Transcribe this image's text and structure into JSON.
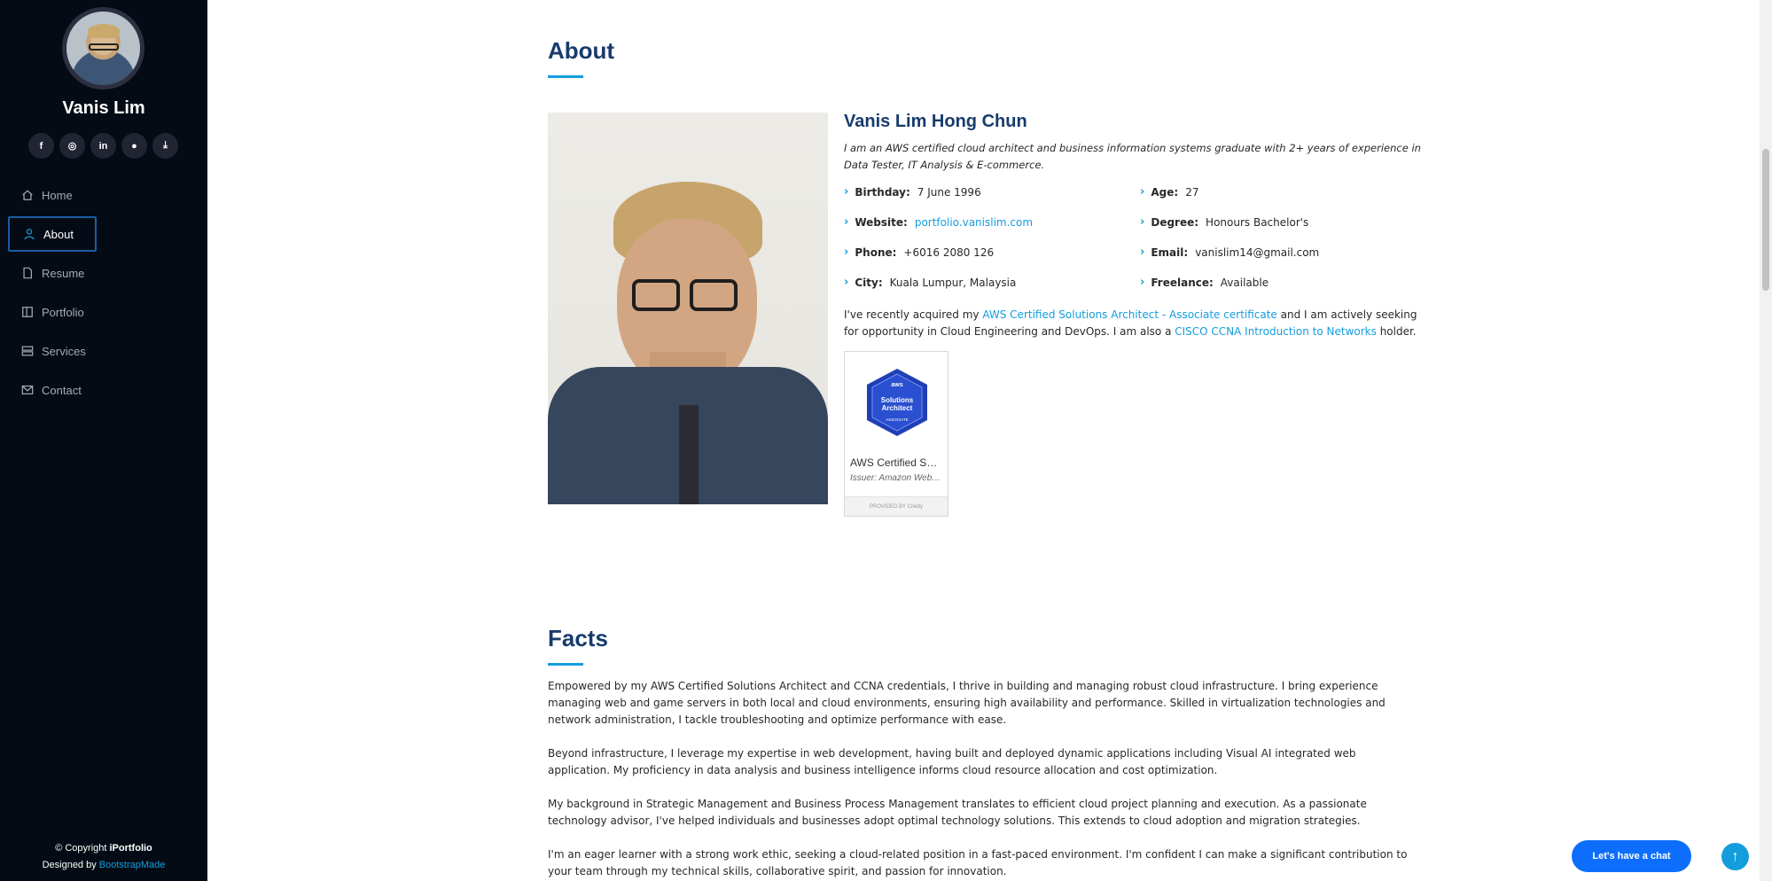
{
  "sidebar": {
    "name": "Vanis Lim",
    "socials": [
      {
        "icon": "facebook-icon",
        "glyph": "f"
      },
      {
        "icon": "instagram-icon",
        "glyph": "◎"
      },
      {
        "icon": "linkedin-icon",
        "glyph": "in"
      },
      {
        "icon": "github-icon",
        "glyph": "●"
      },
      {
        "icon": "download-icon",
        "glyph": "⤓"
      }
    ],
    "nav": [
      {
        "label": "Home",
        "icon": "house-icon",
        "active": false
      },
      {
        "label": "About",
        "icon": "person-icon",
        "active": true
      },
      {
        "label": "Resume",
        "icon": "file-icon",
        "active": false
      },
      {
        "label": "Portfolio",
        "icon": "book-icon",
        "active": false
      },
      {
        "label": "Services",
        "icon": "server-icon",
        "active": false
      },
      {
        "label": "Contact",
        "icon": "envelope-icon",
        "active": false
      }
    ],
    "footer": {
      "copyright_prefix": "© Copyright ",
      "brand": "iPortfolio",
      "designed_prefix": "Designed by ",
      "designer": "BootstrapMade"
    }
  },
  "about": {
    "title": "About",
    "name": "Vanis Lim Hong Chun",
    "intro": "I am an AWS certified cloud architect and business information systems graduate with 2+ years of experience in Data Tester, IT Analysis & E-commerce.",
    "info": {
      "birthday": {
        "label": "Birthday:",
        "value": "7 June 1996"
      },
      "age": {
        "label": "Age:",
        "value": "27"
      },
      "website": {
        "label": "Website:",
        "value": "portfolio.vanislim.com"
      },
      "degree": {
        "label": "Degree:",
        "value": "Honours Bachelor's"
      },
      "phone": {
        "label": "Phone:",
        "value": "+6016 2080 126"
      },
      "email": {
        "label": "Email:",
        "value": "vanislim14@gmail.com"
      },
      "city": {
        "label": "City:",
        "value": "Kuala Lumpur, Malaysia"
      },
      "freelance": {
        "label": "Freelance:",
        "value": "Available"
      }
    },
    "para": {
      "p1": "I've recently acquired my ",
      "link1": "AWS Certified Solutions Architect - Associate certificate",
      "p2": " and I am actively seeking for opportunity in Cloud Engineering and DevOps. I am also a ",
      "link2": "CISCO CCNA Introduction to Networks",
      "p3": " holder."
    },
    "badge": {
      "hex_top": "aws",
      "hex_line1": "Solutions",
      "hex_line2": "Architect",
      "hex_line3": "ASSOCIATE",
      "title": "AWS Certified Solutions Architect – Associate",
      "issuer": "Issuer: Amazon Web Services Training and Certification",
      "footer": "PROVIDED BY Credly"
    }
  },
  "facts": {
    "title": "Facts",
    "paragraphs": [
      "Empowered by my AWS Certified Solutions Architect and CCNA credentials, I thrive in building and managing robust cloud infrastructure. I bring experience managing web and game servers in both local and cloud environments, ensuring high availability and performance. Skilled in virtualization technologies and network administration, I tackle troubleshooting and optimize performance with ease.",
      "Beyond infrastructure, I leverage my expertise in web development, having built and deployed dynamic applications including Visual AI integrated web application. My proficiency in data analysis and business intelligence informs cloud resource allocation and cost optimization.",
      "My background in Strategic Management and Business Process Management translates to efficient cloud project planning and execution. As a passionate technology advisor, I've helped individuals and businesses adopt optimal technology solutions. This extends to cloud adoption and migration strategies.",
      "I'm an eager learner with a strong work ethic, seeking a cloud-related position in a fast-paced environment. I'm confident I can make a significant contribution to your team through my technical skills, collaborative spirit, and passion for innovation."
    ]
  },
  "chat_button": "Let's have a chat",
  "colors": {
    "accent": "#149ddd",
    "sidebar_bg": "#040b14",
    "heading": "#173b6c",
    "chat": "#0d6efd"
  }
}
